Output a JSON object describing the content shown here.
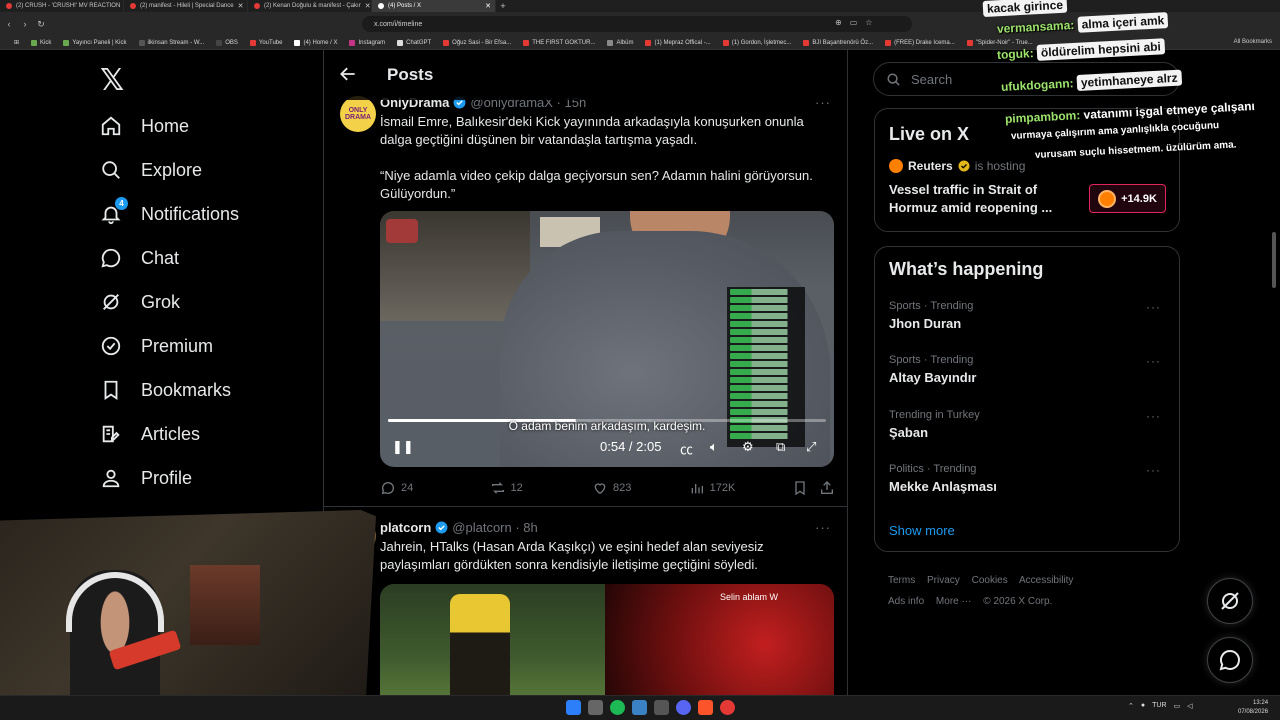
{
  "browser": {
    "tabs": [
      {
        "title": "(2) CRUSH - 'CRUSH!' MV REACTION"
      },
      {
        "title": "(2) manifest - Hileli | Special Dance"
      },
      {
        "title": "(2) Kenan Doğulu & manifest - Çakır"
      },
      {
        "title": "(4) Posts / X",
        "active": true
      }
    ],
    "url": "x.com/i/timeline",
    "bookmarks": [
      "Kick",
      "Yayıncı Paneli | Kick",
      "ilkinsan Stream - W...",
      "OBS",
      "YouTube",
      "(4) Home / X",
      "Instagram",
      "ChatGPT",
      "Oğuz Sasi - Bir Efsa...",
      "THE FIRST GOKTUR...",
      "Albüm",
      "(1) Mepraz Offical -...",
      "(1) Gordon, İşletmec...",
      "BJI Başantrenörü Öz...",
      "(FREE) Drake Icema...",
      "\"Spider-Noir\" - True..."
    ],
    "bookmarks_right": "All Bookmarks"
  },
  "nav": {
    "items": [
      {
        "label": "Home",
        "icon": "home-icon"
      },
      {
        "label": "Explore",
        "icon": "search-icon"
      },
      {
        "label": "Notifications",
        "icon": "bell-icon",
        "badge": "4"
      },
      {
        "label": "Chat",
        "icon": "chat-icon"
      },
      {
        "label": "Grok",
        "icon": "grok-icon"
      },
      {
        "label": "Premium",
        "icon": "premium-icon"
      },
      {
        "label": "Bookmarks",
        "icon": "bookmark-icon"
      },
      {
        "label": "Articles",
        "icon": "articles-icon"
      },
      {
        "label": "Profile",
        "icon": "profile-icon"
      }
    ]
  },
  "header": {
    "title": "Posts"
  },
  "posts": [
    {
      "name": "OnlyDrama",
      "handle": "@onlydramaX · 15h",
      "avatar_text": "ONLY DRAMA",
      "text": "İsmail Emre, Balıkesir'deki Kick yayınında arkadaşıyla konuşurken onunla dalga geçtiğini düşünen bir vatandaşla tartışma yaşadı.\n\n“Niye adamla video çekip dalga geçiyorsun sen? Adamın halini görüyorsun. Gülüyordun.”",
      "video": {
        "subtitle": "O adam benim arkadaşım, kardeşim.",
        "time": "0:54 / 2:05",
        "progress": 0.43
      },
      "stats": {
        "replies": "24",
        "reposts": "12",
        "likes": "823",
        "views": "172K"
      }
    },
    {
      "name": "platcorn",
      "handle": "@platcorn · 8h",
      "text": "Jahrein, HTalks (Hasan Arda Kaşıkçı) ve eşini hedef alan seviyesiz paylaşımları gördükten sonra kendisiyle iletişime geçtiğini söyledi.",
      "media_label": "Selin ablam W"
    }
  ],
  "sidebar": {
    "search_placeholder": "Search",
    "live": {
      "title": "Live on X",
      "source": "Reuters",
      "status": "is hosting",
      "headline": "Vessel traffic in Strait of Hormuz amid reopening ...",
      "count": "+14.9K"
    },
    "happening": {
      "title": "What’s happening",
      "trends": [
        {
          "meta": "Sports · Trending",
          "name": "Jhon Duran"
        },
        {
          "meta": "Sports · Trending",
          "name": "Altay Bayındır"
        },
        {
          "meta": "Trending in Turkey",
          "name": "Şaban"
        },
        {
          "meta": "Politics · Trending",
          "name": "Mekke Anlaşması"
        }
      ],
      "show_more": "Show more"
    },
    "footer": [
      "Terms",
      "Privacy",
      "Cookies",
      "Accessibility",
      "Ads info",
      "More ···",
      "© 2026 X Corp."
    ]
  },
  "stream_chat": [
    {
      "user": "",
      "msg": "kacak girince"
    },
    {
      "user": "vermansama:",
      "msg": "alma içeri amk"
    },
    {
      "user": "toguk:",
      "msg": "öldürelim hepsini abi"
    },
    {
      "user": "ufukdogann:",
      "msg": "yetimhaneye alrz"
    },
    {
      "user": "pimpambom:",
      "msg": "vatanımı işgal etmeye çalışanı"
    },
    {
      "user": "",
      "msg": "vurmaya çalışırım ama yanlışlıkla çocuğunu"
    },
    {
      "user": "",
      "msg": "vurusam suçlu hissetmem. üzülürüm ama."
    }
  ],
  "taskbar": {
    "lang": "TUR",
    "time": "13:24",
    "date": "07/08/2026"
  },
  "colors": {
    "accent": "#1d9bf0",
    "live_border": "#e0245e",
    "reuters": "#ff8000",
    "bg": "#000000"
  }
}
